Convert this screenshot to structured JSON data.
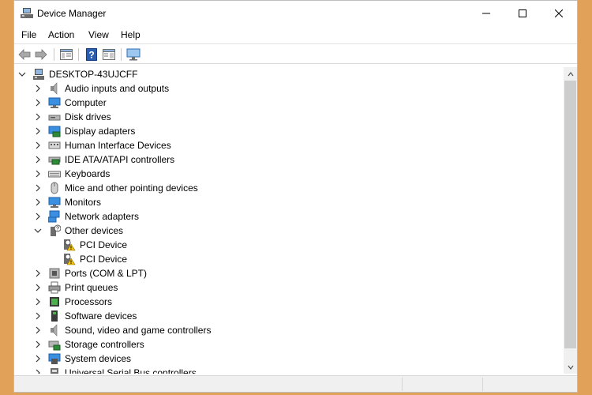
{
  "window": {
    "title": "Device Manager"
  },
  "menu": [
    "File",
    "Action",
    "View",
    "Help"
  ],
  "toolbar": {
    "icons": [
      "back-arrow-icon",
      "forward-arrow-icon",
      "properties-icon",
      "help-icon",
      "action-pane-icon",
      "monitor-icon"
    ]
  },
  "tree": {
    "root": "DESKTOP-43UJCFF",
    "items": [
      {
        "label": "Audio inputs and outputs",
        "icon": "speaker-icon",
        "expanded": false
      },
      {
        "label": "Computer",
        "icon": "computer-icon",
        "expanded": false
      },
      {
        "label": "Disk drives",
        "icon": "disk-drive-icon",
        "expanded": false
      },
      {
        "label": "Display adapters",
        "icon": "display-adapter-icon",
        "expanded": false
      },
      {
        "label": "Human Interface Devices",
        "icon": "hid-icon",
        "expanded": false
      },
      {
        "label": "IDE ATA/ATAPI controllers",
        "icon": "ide-controller-icon",
        "expanded": false
      },
      {
        "label": "Keyboards",
        "icon": "keyboard-icon",
        "expanded": false
      },
      {
        "label": "Mice and other pointing devices",
        "icon": "mouse-icon",
        "expanded": false
      },
      {
        "label": "Monitors",
        "icon": "monitor-icon",
        "expanded": false
      },
      {
        "label": "Network adapters",
        "icon": "network-adapter-icon",
        "expanded": false
      },
      {
        "label": "Other devices",
        "icon": "unknown-device-icon",
        "expanded": true
      },
      {
        "label": "PCI Device",
        "icon": "warning-device-icon",
        "child": true
      },
      {
        "label": "PCI Device",
        "icon": "warning-device-icon",
        "child": true
      },
      {
        "label": "Ports (COM & LPT)",
        "icon": "port-icon",
        "expanded": false
      },
      {
        "label": "Print queues",
        "icon": "printer-icon",
        "expanded": false
      },
      {
        "label": "Processors",
        "icon": "processor-icon",
        "expanded": false
      },
      {
        "label": "Software devices",
        "icon": "software-device-icon",
        "expanded": false
      },
      {
        "label": "Sound, video and game controllers",
        "icon": "speaker-icon",
        "expanded": false
      },
      {
        "label": "Storage controllers",
        "icon": "storage-controller-icon",
        "expanded": false
      },
      {
        "label": "System devices",
        "icon": "system-device-icon",
        "expanded": false
      },
      {
        "label": "Universal Serial Bus controllers",
        "icon": "usb-icon",
        "expanded": false
      }
    ]
  },
  "colors": {
    "accent": "#0078d7",
    "warning": "#f5c400",
    "desktop_bg": "#e2a158"
  }
}
